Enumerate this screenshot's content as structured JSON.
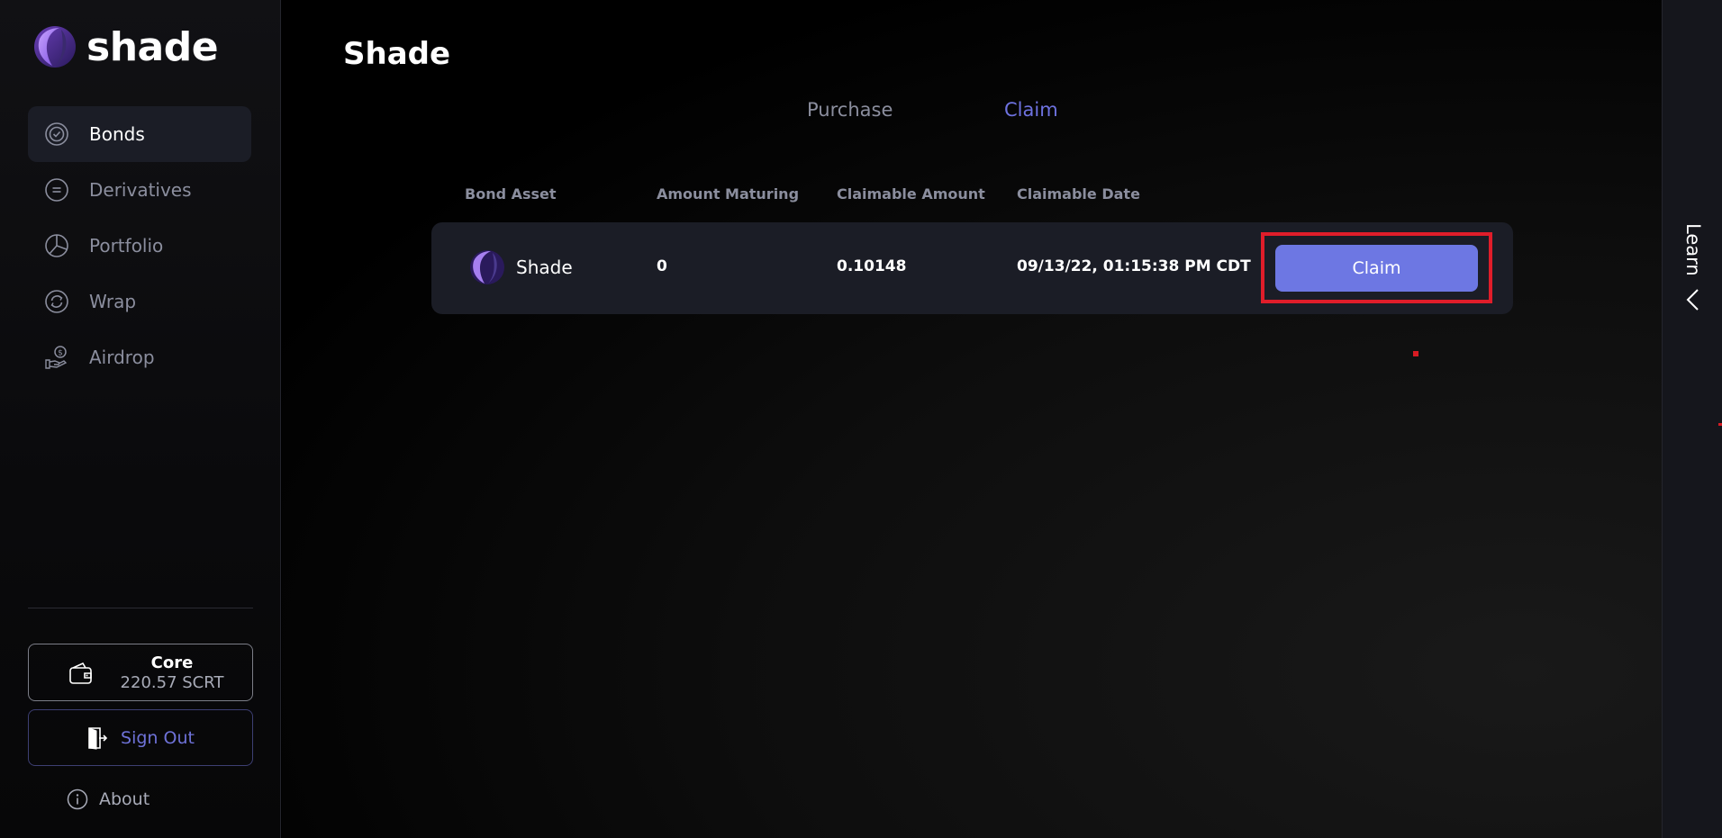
{
  "brand": {
    "name": "shade"
  },
  "nav": {
    "items": [
      {
        "label": "Bonds",
        "icon": "bonds-icon",
        "active": true
      },
      {
        "label": "Derivatives",
        "icon": "derivatives-icon",
        "active": false
      },
      {
        "label": "Portfolio",
        "icon": "portfolio-icon",
        "active": false
      },
      {
        "label": "Wrap",
        "icon": "wrap-icon",
        "active": false
      },
      {
        "label": "Airdrop",
        "icon": "airdrop-icon",
        "active": false
      }
    ]
  },
  "wallet": {
    "name": "Core",
    "balance": "220.57 SCRT",
    "icon": "wallet-icon"
  },
  "signout": {
    "label": "Sign Out",
    "icon": "door-exit-icon"
  },
  "about": {
    "label": "About",
    "icon": "info-icon"
  },
  "page": {
    "title": "Shade"
  },
  "tabs": [
    {
      "label": "Purchase",
      "active": false
    },
    {
      "label": "Claim",
      "active": true
    }
  ],
  "table": {
    "headers": [
      "Bond Asset",
      "Amount Maturing",
      "Claimable Amount",
      "Claimable Date"
    ],
    "rows": [
      {
        "asset": "Shade",
        "amount_maturing": "0",
        "claimable_amount": "0.10148",
        "claimable_date": "09/13/22, 01:15:38 PM CDT",
        "action_label": "Claim"
      }
    ]
  },
  "learn": {
    "label": "Learn",
    "icon": "chevron-left-icon"
  },
  "colors": {
    "accent": "#6d77e3",
    "active_tab": "#6e72e0",
    "highlight": "#e01d2a",
    "row_bg": "#1b1d26"
  }
}
